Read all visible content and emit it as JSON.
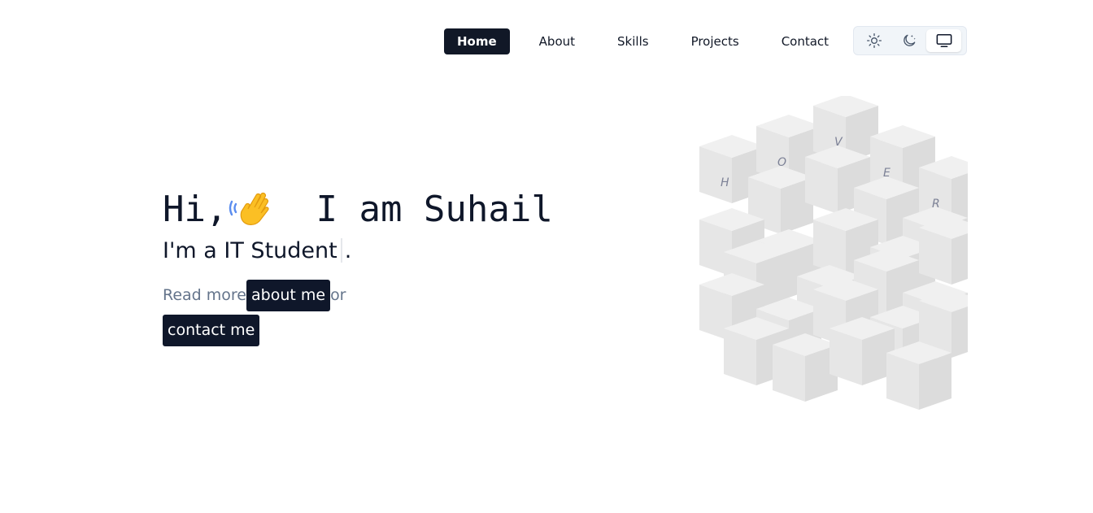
{
  "nav": {
    "items": [
      {
        "label": "Home",
        "active": true
      },
      {
        "label": "About",
        "active": false
      },
      {
        "label": "Skills",
        "active": false
      },
      {
        "label": "Projects",
        "active": false
      },
      {
        "label": "Contact",
        "active": false
      }
    ],
    "theme_switch": {
      "options": [
        "sun-icon",
        "moon-icon",
        "monitor-icon"
      ],
      "selected": "monitor-icon"
    }
  },
  "hero": {
    "greeting": "Hi,",
    "wave_icon": "waving-hand-icon",
    "intro": "I am Suhail",
    "subtitle": "I'm a IT Student",
    "subtitle_suffix": ".",
    "read_more_prefix": "Read more",
    "about_button": "about me",
    "or_text": "or",
    "contact_button": "contact me"
  },
  "cube": {
    "letters": [
      "H",
      "O",
      "V",
      "E",
      "R"
    ]
  },
  "colors": {
    "nav_active_bg": "#111827",
    "text_dark": "#0f172a",
    "muted_text": "#64748b",
    "cube_light": "#f0f0f0",
    "cube_dark": "#dcdcdc"
  }
}
